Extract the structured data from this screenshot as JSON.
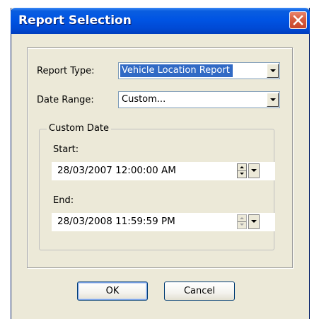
{
  "window": {
    "title": "Report Selection"
  },
  "report_type": {
    "label": "Report Type:",
    "value": "Vehicle Location Report"
  },
  "date_range": {
    "label": "Date Range:",
    "value": "Custom..."
  },
  "custom_date": {
    "legend": "Custom Date",
    "start_label": "Start:",
    "start_value": "28/03/2007 12:00:00 AM",
    "end_label": "End:",
    "end_value": "28/03/2008 11:59:59 PM"
  },
  "buttons": {
    "ok": "OK",
    "cancel": "Cancel"
  },
  "icons": {
    "close": "close-icon",
    "dropdown": "chevron-down-icon",
    "spin": "spin-updown-icon"
  },
  "colors": {
    "titlebar": "#0054e3",
    "face": "#ece9d8",
    "selection": "#316ac5",
    "close": "#d85f42"
  }
}
